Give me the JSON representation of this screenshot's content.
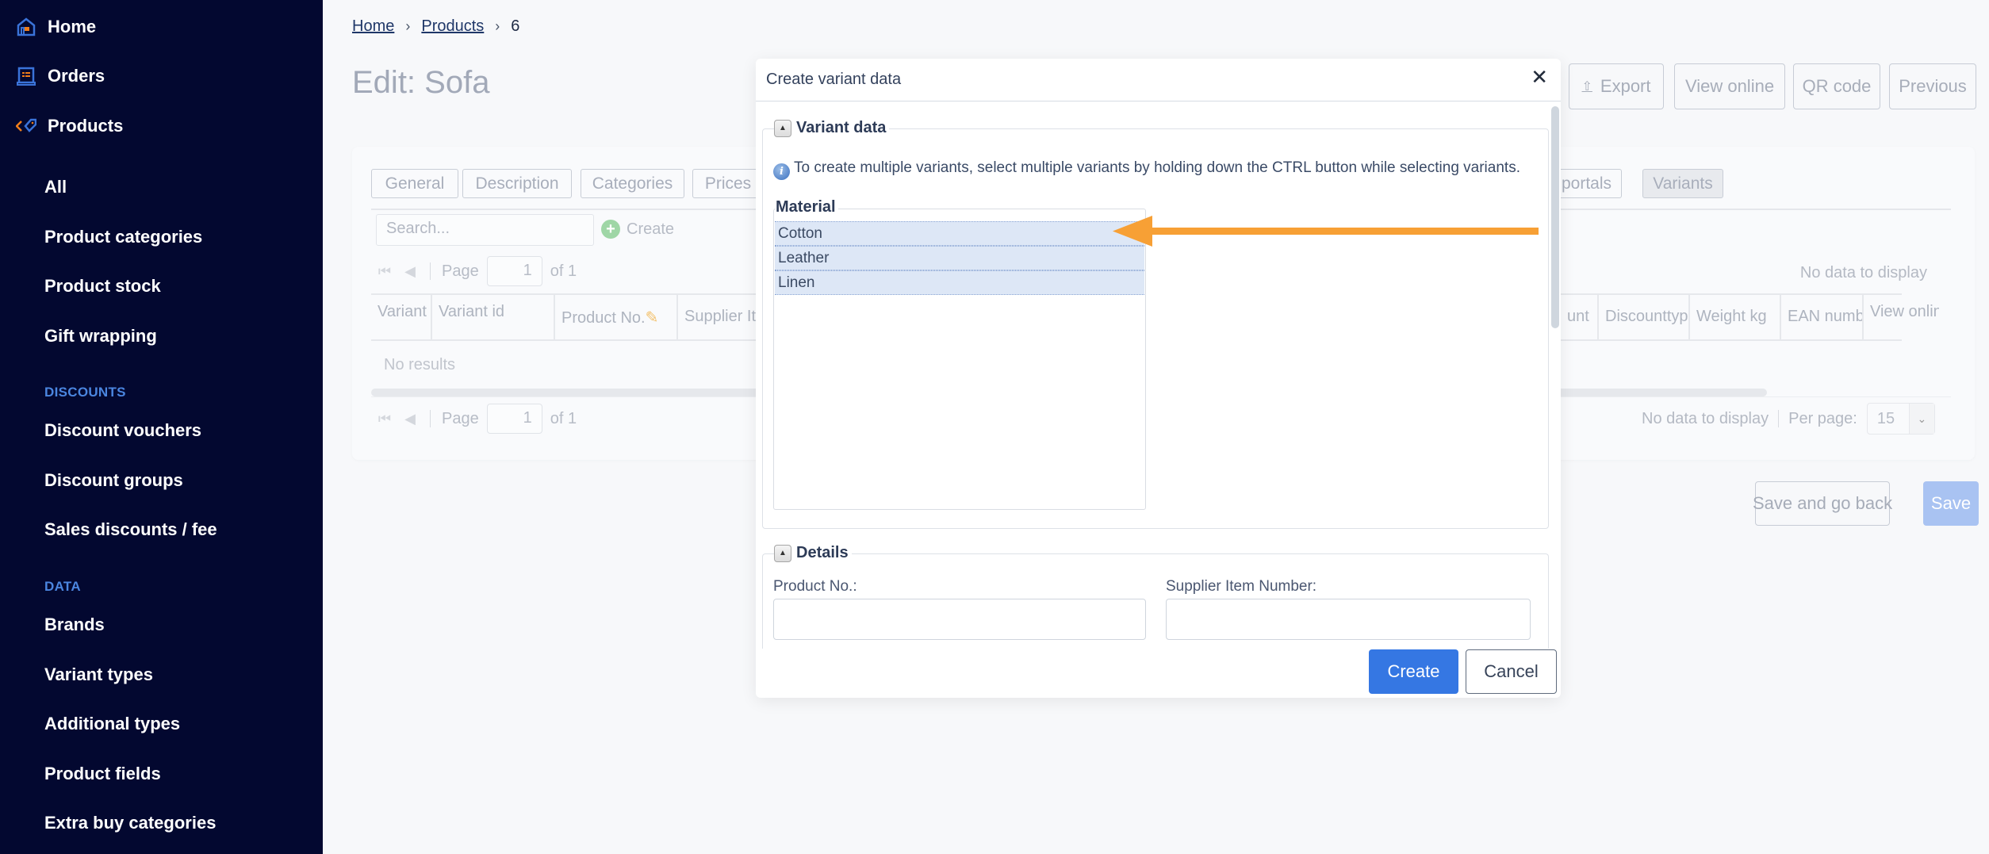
{
  "sidebar": {
    "top_items": [
      {
        "label": "Home",
        "icon": "home-icon"
      },
      {
        "label": "Orders",
        "icon": "orders-icon"
      },
      {
        "label": "Products",
        "icon": "tag-icon"
      }
    ],
    "product_items": [
      "All",
      "Product categories",
      "Product stock",
      "Gift wrapping"
    ],
    "discounts_section": "DISCOUNTS",
    "discount_items": [
      "Discount vouchers",
      "Discount groups",
      "Sales discounts / fee"
    ],
    "data_section": "DATA",
    "data_items": [
      "Brands",
      "Variant types",
      "Additional types",
      "Product fields",
      "Extra buy categories"
    ]
  },
  "breadcrumb": {
    "items": [
      "Home",
      "Products"
    ],
    "current": "6",
    "separator": "›"
  },
  "page": {
    "title": "Edit: Sofa"
  },
  "header_actions": {
    "export": "Export",
    "export_icon": "upload-icon",
    "view_online": "View online",
    "qr_code": "QR code",
    "previous": "Previous"
  },
  "tabs": {
    "items": [
      "General",
      "Description",
      "Categories",
      "Prices",
      "e portals",
      "Variants"
    ],
    "active": "Variants"
  },
  "grid": {
    "search_placeholder": "Search...",
    "create_label": "Create",
    "pager": {
      "page_label": "Page",
      "page_value": "1",
      "of_label": "of 1"
    },
    "columns_left": [
      "Variant",
      "Variant id",
      "Product No.",
      "Supplier It"
    ],
    "columns_right": [
      "unt",
      "Discounttype",
      "Weight kg",
      "EAN numbe",
      "View onlin"
    ],
    "no_results": "No results",
    "no_data": "No data to display",
    "per_page_label": "Per page:",
    "per_page_value": "15"
  },
  "footer_actions": {
    "save_and_go_back": "Save and go back",
    "save": "Save"
  },
  "modal": {
    "title": "Create variant data",
    "close_symbol": "✕",
    "variant_section": {
      "legend": "Variant data",
      "info": "To create multiple variants, select multiple variants by holding down the CTRL button while selecting variants.",
      "material_label": "Material",
      "material_options": [
        "Cotton",
        "Leather",
        "Linen"
      ],
      "selected": [
        "Cotton",
        "Leather",
        "Linen"
      ]
    },
    "details_section": {
      "legend": "Details",
      "product_no_label": "Product No.:",
      "product_no_value": "",
      "supplier_item_label": "Supplier Item Number:",
      "supplier_item_value": ""
    },
    "create_button": "Create",
    "cancel_button": "Cancel"
  },
  "annotation": {
    "arrow_color": "#f7a035",
    "points_to": "Cotton"
  },
  "colors": {
    "sidebar_bg": "#030830",
    "section_heading": "#4b86e0",
    "primary_button": "#3577e3",
    "selection_bg": "#dde7f6"
  }
}
